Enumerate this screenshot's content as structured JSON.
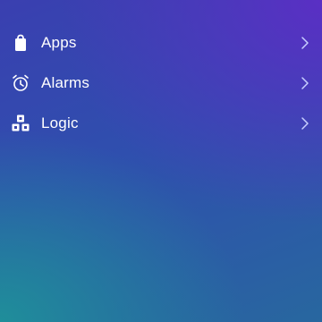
{
  "menu": {
    "items": [
      {
        "label": "Apps",
        "icon": "shopping-bag-icon"
      },
      {
        "label": "Alarms",
        "icon": "alarm-clock-icon"
      },
      {
        "label": "Logic",
        "icon": "blocks-icon"
      }
    ]
  },
  "colors": {
    "text": "#ffffff",
    "chevron": "#c8d0ff"
  }
}
